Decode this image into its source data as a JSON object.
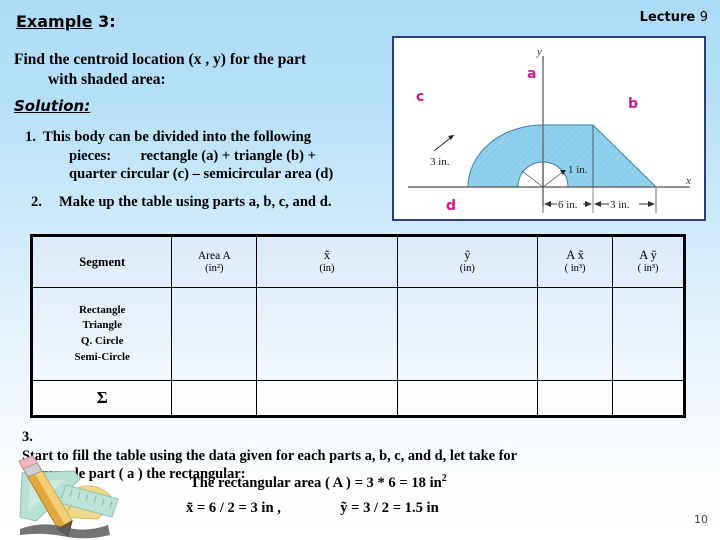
{
  "header": {
    "lecture_label": "Lecture",
    "lecture_number": "9",
    "example_word": "Example",
    "example_number": "3:"
  },
  "prompt": {
    "line1": "Find the centroid location (x , y) for the part",
    "line2": "with shaded area:"
  },
  "solution": {
    "label": "Solution:"
  },
  "steps": [
    {
      "number": "1.",
      "line1": "This body can be divided into the following",
      "line2": "pieces:        rectangle (a) +  triangle (b)  +",
      "line3": "quarter circular (c)  –  semicircular area (d)"
    },
    {
      "number": "2.",
      "line1": "Make up the table using parts a, b, c, and d."
    }
  ],
  "figure": {
    "labels": {
      "a": "a",
      "b": "b",
      "c": "c",
      "d": "d"
    },
    "axis_x": "x",
    "axis_y": "y",
    "dim_radius_outer": "3 in.",
    "dim_radius_inner": "1 in.",
    "dim_base": "6 in.",
    "dim_right": "3 in.",
    "shade_color": "#89ceea",
    "label_color": "#d6168c",
    "border_color": "#2e3c78"
  },
  "table": {
    "headers": [
      {
        "main": "Segment",
        "unit": ""
      },
      {
        "main": "Area A",
        "unit": "(in²)"
      },
      {
        "main": "x̃",
        "unit": "(in)"
      },
      {
        "main": "ỹ",
        "unit": "(in)"
      },
      {
        "main": "A x̃",
        "unit": "( in³)"
      },
      {
        "main": "A ỹ",
        "unit": "( in³)"
      }
    ],
    "segments": [
      "Rectangle",
      "Triangle",
      "Q. Circle",
      "Semi-Circle"
    ],
    "sum_label": "Σ",
    "body_values": [
      "",
      "",
      "",
      "",
      ""
    ],
    "sum_values": [
      "",
      "",
      "",
      "",
      ""
    ]
  },
  "step3": {
    "number": "3.",
    "line1": "Start to fill the table using the data given for each parts a, b, c, and d, let take for",
    "line2": "example part ( a ) the rectangular:"
  },
  "formulas": {
    "area_line": "The rectangular area ( A ) = 3  *  6  =  18 in",
    "area_exp": "2",
    "xbar": "x̃ =  6 / 2  =  3  in ,",
    "ybar": "ỹ  =  3 / 2  =  1.5 in"
  },
  "footer": {
    "page_number": "10"
  }
}
